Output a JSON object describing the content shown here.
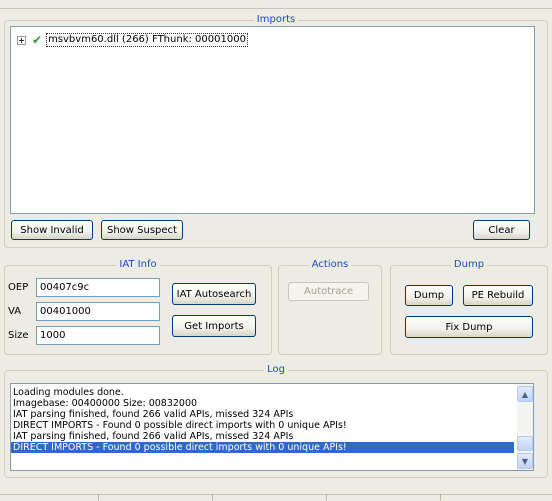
{
  "imports": {
    "title": "Imports",
    "tree_item": "msvbvm60.dll (266) FThunk: 00001000",
    "show_invalid": "Show Invalid",
    "show_suspect": "Show Suspect",
    "clear": "Clear"
  },
  "iat_info": {
    "title": "IAT Info",
    "oep_label": "OEP",
    "oep_value": "00407c9c",
    "va_label": "VA",
    "va_value": "00401000",
    "size_label": "Size",
    "size_value": "1000",
    "autosearch": "IAT Autosearch",
    "get_imports": "Get Imports"
  },
  "actions": {
    "title": "Actions",
    "autotrace": "Autotrace"
  },
  "dump": {
    "title": "Dump",
    "dump": "Dump",
    "pe_rebuild": "PE Rebuild",
    "fix_dump": "Fix Dump"
  },
  "log": {
    "title": "Log",
    "lines": [
      "Loading modules done.",
      "Imagebase: 00400000 Size: 00832000",
      "IAT parsing finished, found 266 valid APIs, missed 324 APIs",
      "DIRECT IMPORTS - Found 0 possible direct imports with 0 unique APIs!",
      "IAT parsing finished, found 266 valid APIs, missed 324 APIs",
      "DIRECT IMPORTS - Found 0 possible direct imports with 0 unique APIs!"
    ]
  },
  "icons": {
    "expand": "plus-expander-icon",
    "check": "green-check-icon",
    "scroll_up": "scroll-up-arrow-icon",
    "scroll_down": "scroll-down-arrow-icon"
  },
  "colors": {
    "group_title": "#1f4dbf",
    "selection": "#316ac5",
    "check": "#2aa02a",
    "window_bg": "#ecebe4"
  }
}
